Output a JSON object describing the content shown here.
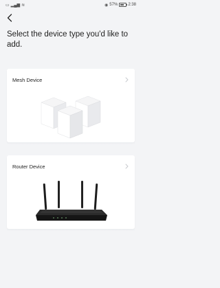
{
  "status_bar": {
    "left_icons": [
      "notification-icon",
      "signal-icon",
      "wifi-icon"
    ],
    "battery_percent": "57%",
    "time": "2:38"
  },
  "header": {
    "back_icon": "chevron-left-icon",
    "title": "Select the device type you'd like to add."
  },
  "device_types": [
    {
      "label": "Mesh Device",
      "icon": "mesh-units-image"
    },
    {
      "label": "Router Device",
      "icon": "router-image"
    }
  ],
  "colors": {
    "background": "#f3f4f6",
    "card": "#ffffff",
    "text": "#222222"
  }
}
